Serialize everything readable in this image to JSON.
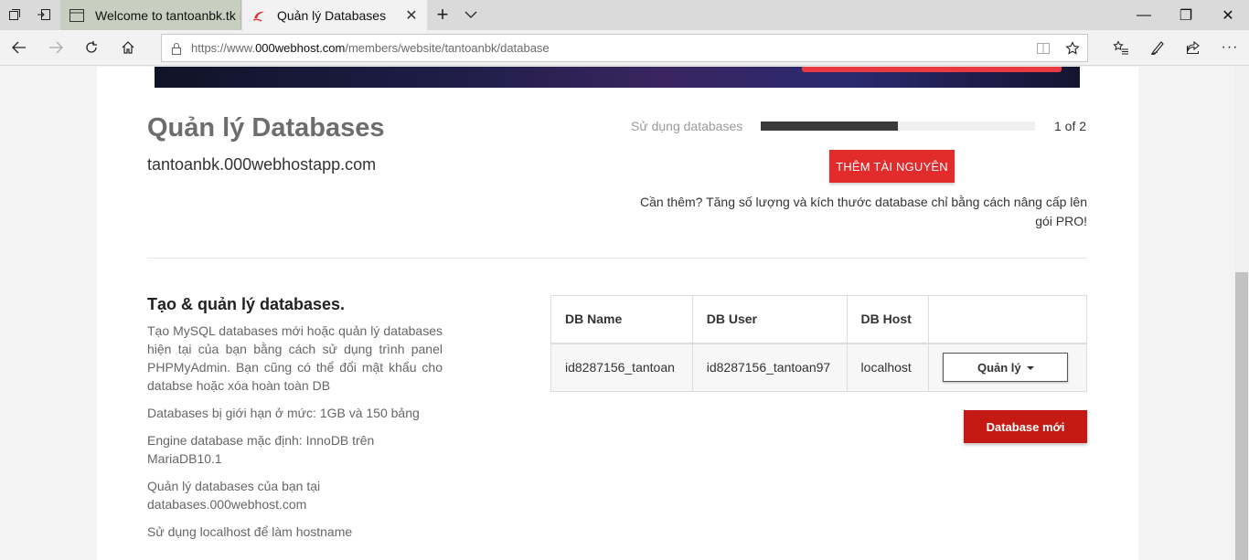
{
  "browser": {
    "tabs": [
      {
        "title": "Welcome to tantoanbk.tk Fr",
        "active": false
      },
      {
        "title": "Quản lý Databases",
        "active": true
      }
    ],
    "close_glyph": "✕",
    "new_tab_glyph": "+",
    "tab_list_glyph": "⌵",
    "window_controls": {
      "minimize": "—",
      "maximize": "❐",
      "close": "✕"
    },
    "url_prefix": "https://www.",
    "url_host": "000webhost.com",
    "url_path": "/members/website/tantoanbk/database",
    "more_glyph": "···"
  },
  "page": {
    "title": "Quản lý Databases",
    "domain": "tantoanbk.000webhostapp.com",
    "usage": {
      "label": "Sử dụng databases",
      "used": 1,
      "total": 2,
      "count_text": "1 of 2"
    },
    "add_resource_button": "THÊM TÀI NGUYÊN",
    "upgrade_note": "Cần thêm? Tăng số lượng và kích thước database chỉ bằng cách nâng cấp lên gói PRO!",
    "section": {
      "title": "Tạo & quản lý databases.",
      "description": "Tạo MySQL databases mới hoặc quản lý databases hiện tại của bạn bằng cách sử dụng trình panel PHPMyAdmin. Bạn cũng có thể đổi mật khẩu cho databse hoặc xóa hoàn toàn DB",
      "limits": "Databases bị giới hạn ở mức: 1GB và 150 bảng",
      "engine": "Engine database mặc định: InnoDB trên MariaDB10.1",
      "manage_at": "Quản lý databases của bạn tại databases.000webhost.com",
      "hostname_tip": "Sử dụng localhost để làm hostname"
    },
    "table": {
      "headers": [
        "DB Name",
        "DB User",
        "DB Host",
        ""
      ],
      "rows": [
        {
          "name": "id8287156_tantoan",
          "user": "id8287156_tantoan97",
          "host": "localhost",
          "action": "Quản lý"
        }
      ]
    },
    "new_db_button": "Database mới"
  },
  "colors": {
    "accent_red": "#e22b2b",
    "dark_red": "#c51a14",
    "bar": "#3a3a3a"
  }
}
